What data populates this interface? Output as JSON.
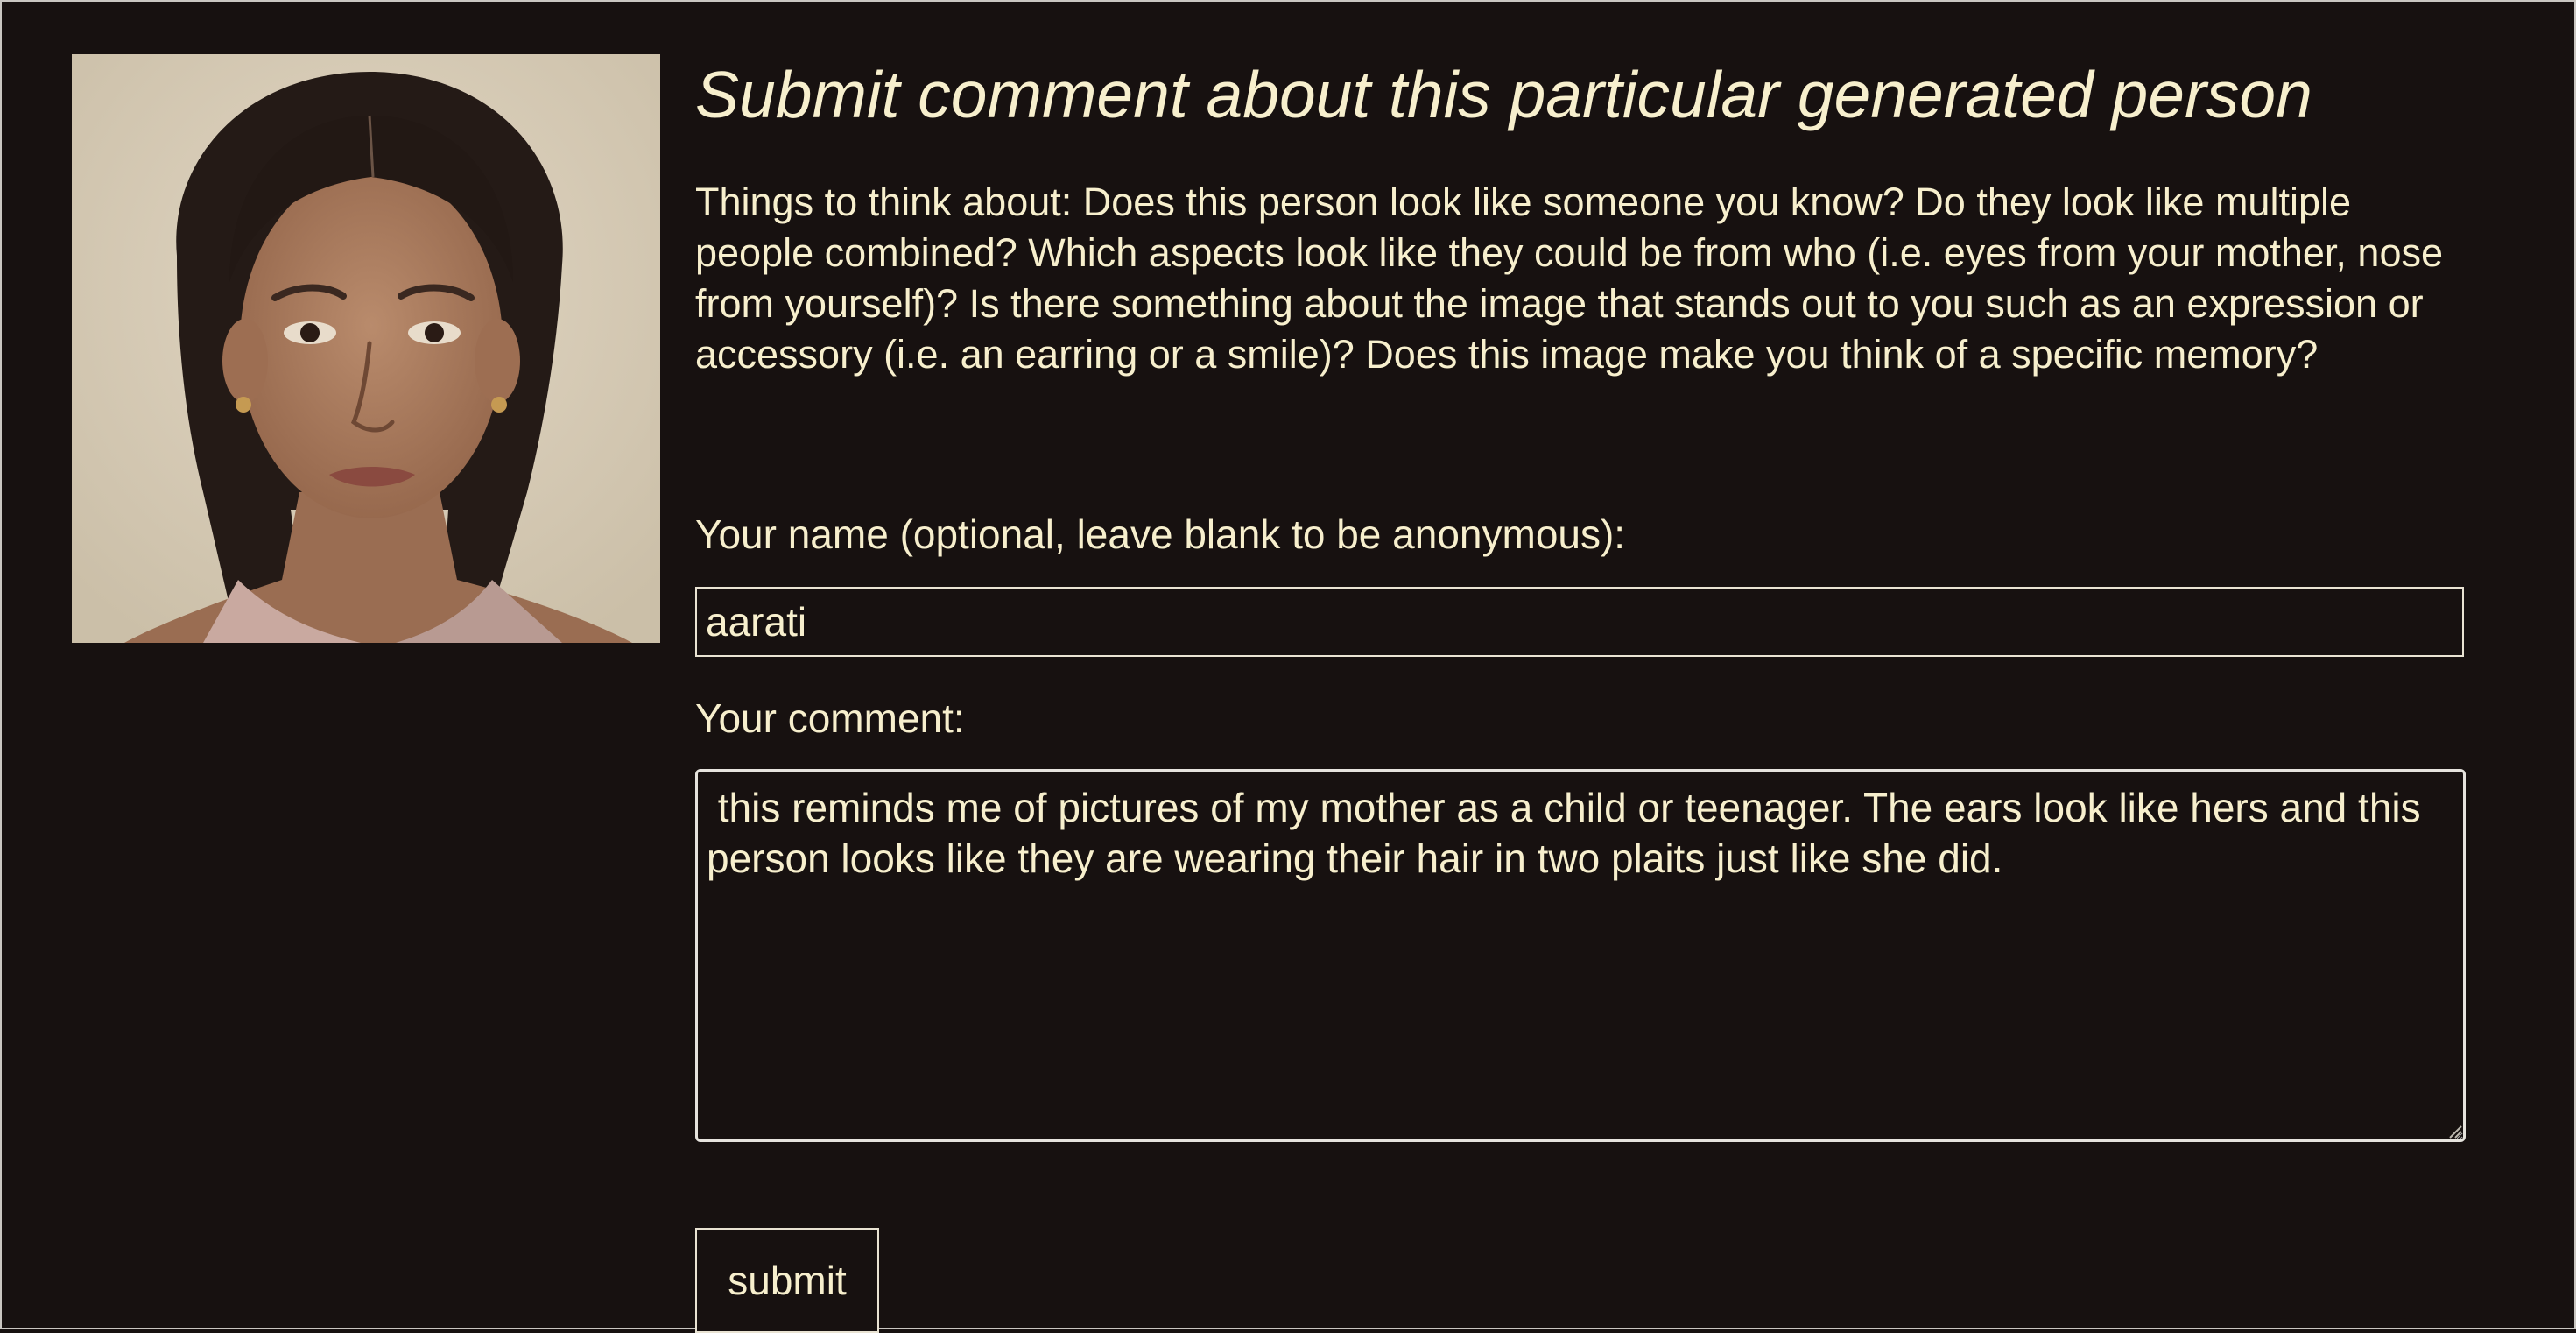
{
  "portrait": {
    "icon": "generated-person-portrait"
  },
  "form": {
    "title": "Submit comment about this particular generated person",
    "prompt": "Things to think about: Does this person look like someone you know? Do they look like multiple people combined? Which aspects look like they could be from who (i.e. eyes from your mother, nose from yourself)? Is there something about the image that stands out to you such as an expression or accessory (i.e. an earring or a smile)? Does this image make you think of a specific memory?",
    "name_label": "Your name (optional, leave blank to be anonymous):",
    "name_value": "aarati",
    "comment_label": "Your comment:",
    "comment_value": " this reminds me of pictures of my mother as a child or teenager. The ears look like hers and this person looks like they are wearing their hair in two plaits just like she did.",
    "submit_label": "submit"
  },
  "colors": {
    "background": "#171110",
    "text": "#f7efcd",
    "border": "#e9e3d3"
  }
}
